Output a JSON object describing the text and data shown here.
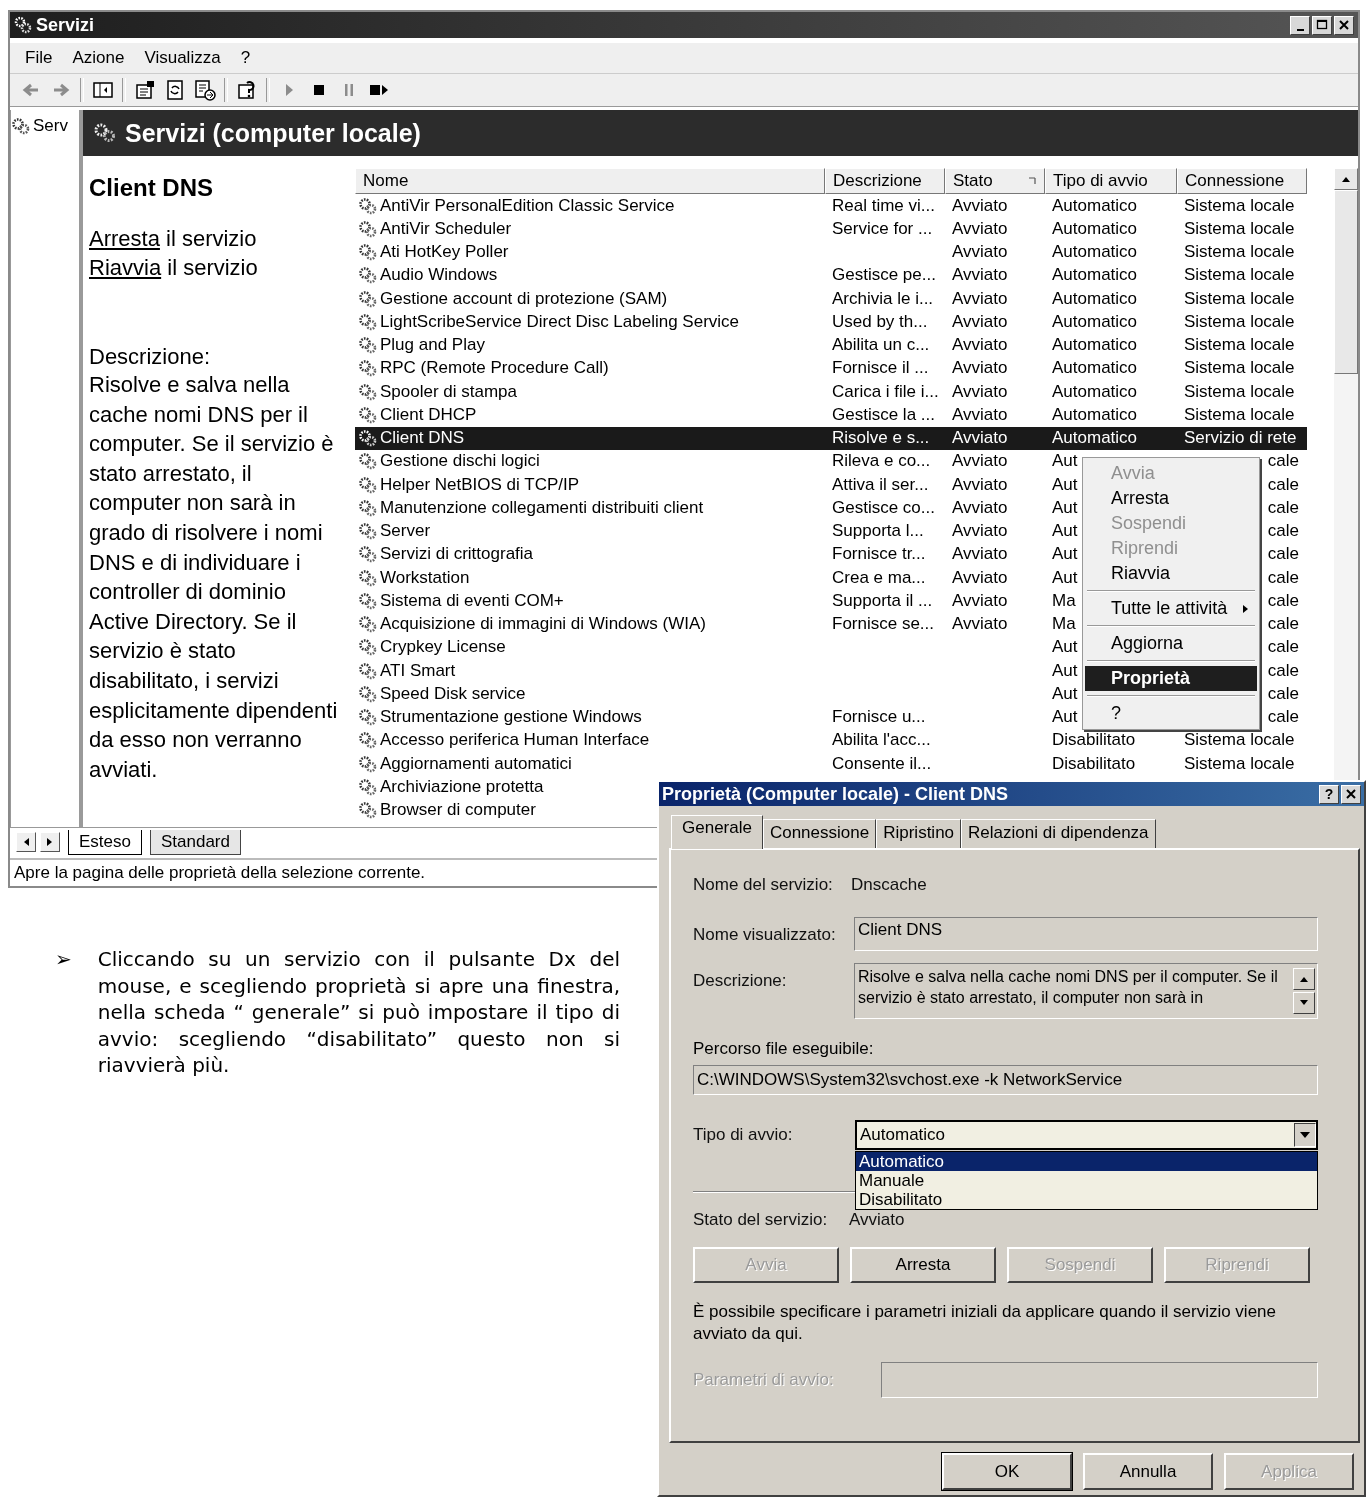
{
  "window": {
    "title": "Servizi"
  },
  "menu": [
    "File",
    "Azione",
    "Visualizza",
    "?"
  ],
  "toolbar": [
    {
      "kind": "back",
      "disabled": true
    },
    {
      "kind": "forward",
      "disabled": true
    },
    {
      "kind": "separator"
    },
    {
      "kind": "tree",
      "disabled": false
    },
    {
      "kind": "separator"
    },
    {
      "kind": "properties",
      "disabled": false
    },
    {
      "kind": "refresh",
      "disabled": false
    },
    {
      "kind": "export",
      "disabled": false
    },
    {
      "kind": "separator"
    },
    {
      "kind": "help",
      "disabled": false
    },
    {
      "kind": "separator"
    },
    {
      "kind": "play",
      "disabled": true
    },
    {
      "kind": "stop",
      "disabled": false
    },
    {
      "kind": "pause",
      "disabled": true
    },
    {
      "kind": "restart",
      "disabled": false
    }
  ],
  "tree": {
    "items": [
      {
        "label": "Serv",
        "selected": false
      }
    ]
  },
  "header": {
    "title": "Servizi (computer locale)"
  },
  "detail": {
    "title": "Client DNS",
    "actions": [
      {
        "link": "Arresta",
        "text": " il servizio"
      },
      {
        "link": "Riavvia",
        "text": " il servizio"
      }
    ],
    "description_label": "Descrizione:",
    "description": "Risolve e salva nella cache nomi DNS per il computer. Se il servizio è stato arrestato, il computer non sarà in grado di risolvere i nomi DNS e di individuare i controller di dominio Active Directory. Se il servizio è stato disabilitato, i servizi esplicitamente dipendenti da esso non verranno avviati."
  },
  "table": {
    "columns": [
      {
        "label": "Nome",
        "sorted": false
      },
      {
        "label": "Descrizione",
        "sorted": false
      },
      {
        "label": "Stato",
        "sorted": true
      },
      {
        "label": "Tipo di avvio",
        "sorted": false
      },
      {
        "label": "Connessione",
        "sorted": false
      }
    ],
    "rows": [
      {
        "name": "AntiVir PersonalEdition Classic Service",
        "description": "Real time vi...",
        "status": "Avviato",
        "startup": "Automatico",
        "logon": "Sistema locale",
        "selected": false
      },
      {
        "name": "AntiVir Scheduler",
        "description": "Service for ...",
        "status": "Avviato",
        "startup": "Automatico",
        "logon": "Sistema locale",
        "selected": false
      },
      {
        "name": "Ati HotKey Poller",
        "status": "Avviato",
        "startup": "Automatico",
        "logon": "Sistema locale",
        "selected": false
      },
      {
        "name": "Audio Windows",
        "description": "Gestisce pe...",
        "status": "Avviato",
        "startup": "Automatico",
        "logon": "Sistema locale",
        "selected": false
      },
      {
        "name": "Gestione account di protezione (SAM)",
        "description": "Archivia le i...",
        "status": "Avviato",
        "startup": "Automatico",
        "logon": "Sistema locale",
        "selected": false
      },
      {
        "name": "LightScribeService Direct Disc Labeling Service",
        "description": "Used by th...",
        "status": "Avviato",
        "startup": "Automatico",
        "logon": "Sistema locale",
        "selected": false
      },
      {
        "name": "Plug and Play",
        "description": "Abilita un c...",
        "status": "Avviato",
        "startup": "Automatico",
        "logon": "Sistema locale",
        "selected": false
      },
      {
        "name": "RPC (Remote Procedure Call)",
        "description": "Fornisce il ...",
        "status": "Avviato",
        "startup": "Automatico",
        "logon": "Sistema locale",
        "selected": false
      },
      {
        "name": "Spooler di stampa",
        "description": "Carica i file i...",
        "status": "Avviato",
        "startup": "Automatico",
        "logon": "Sistema locale",
        "selected": false
      },
      {
        "name": "Client DHCP",
        "description": "Gestisce la ...",
        "status": "Avviato",
        "startup": "Automatico",
        "logon": "Sistema locale",
        "selected": false
      },
      {
        "name": "Client DNS",
        "description": "Risolve e s...",
        "status": "Avviato",
        "startup": "Automatico",
        "logon": "Servizio di rete",
        "selected": true
      },
      {
        "name": "Gestione dischi logici",
        "description": "Rileva e co...",
        "status": "Avviato",
        "startup": "Aut",
        "logon": "cale",
        "covered": true,
        "selected": false
      },
      {
        "name": "Helper NetBIOS di TCP/IP",
        "description": "Attiva il ser...",
        "status": "Avviato",
        "startup": "Aut",
        "logon": "cale",
        "covered": true,
        "selected": false
      },
      {
        "name": "Manutenzione collegamenti distribuiti client",
        "description": "Gestisce co...",
        "status": "Avviato",
        "startup": "Aut",
        "logon": "cale",
        "covered": true,
        "selected": false
      },
      {
        "name": "Server",
        "description": "Supporta l...",
        "status": "Avviato",
        "startup": "Aut",
        "logon": "cale",
        "covered": true,
        "selected": false
      },
      {
        "name": "Servizi di crittografia",
        "description": "Fornisce tr...",
        "status": "Avviato",
        "startup": "Aut",
        "logon": "cale",
        "covered": true,
        "selected": false
      },
      {
        "name": "Workstation",
        "description": "Crea e ma...",
        "status": "Avviato",
        "startup": "Aut",
        "logon": "cale",
        "covered": true,
        "selected": false
      },
      {
        "name": "Sistema di eventi COM+",
        "description": "Supporta il ...",
        "status": "Avviato",
        "startup": "Ma",
        "logon": "cale",
        "covered": true,
        "selected": false
      },
      {
        "name": "Acquisizione di immagini di Windows (WIA)",
        "description": "Fornisce se...",
        "status": "Avviato",
        "startup": "Ma",
        "logon": "cale",
        "covered": true,
        "selected": false
      },
      {
        "name": "Crypkey License",
        "startup": "Aut",
        "logon": "cale",
        "covered": true,
        "selected": false
      },
      {
        "name": "ATI Smart",
        "startup": "Aut",
        "logon": "cale",
        "covered": true,
        "selected": false
      },
      {
        "name": "Speed Disk service",
        "startup": "Aut",
        "logon": "cale",
        "covered": true,
        "selected": false
      },
      {
        "name": "Strumentazione gestione Windows",
        "description": "Fornisce u...",
        "startup": "Aut",
        "logon": "cale",
        "covered": true,
        "selected": false
      },
      {
        "name": "Accesso periferica Human Interface",
        "description": "Abilita l'acc...",
        "startup": "Disabilitato",
        "logon": "Sistema locale",
        "selected": false
      },
      {
        "name": "Aggiornamenti automatici",
        "description": "Consente il...",
        "startup": "Disabilitato",
        "logon": "Sistema locale",
        "selected": false
      },
      {
        "name": "Archiviazione protetta",
        "selected": false
      },
      {
        "name": "Browser di computer",
        "selected": false
      }
    ]
  },
  "view_tabs": [
    {
      "label": "Esteso",
      "selected": true
    },
    {
      "label": "Standard",
      "selected": false
    }
  ],
  "status_bar": "Apre la pagina delle proprietà della selezione corrente.",
  "context_menu": [
    {
      "kind": "item",
      "label": "Avvia",
      "disabled": true,
      "selected": false
    },
    {
      "kind": "item",
      "label": "Arresta",
      "disabled": false,
      "selected": false
    },
    {
      "kind": "item",
      "label": "Sospendi",
      "disabled": true,
      "selected": false
    },
    {
      "kind": "item",
      "label": "Riprendi",
      "disabled": true,
      "selected": false
    },
    {
      "kind": "item",
      "label": "Riavvia",
      "disabled": false,
      "selected": false
    },
    {
      "kind": "separator"
    },
    {
      "kind": "submenu",
      "label": "Tutte le attività",
      "disabled": false,
      "selected": false
    },
    {
      "kind": "separator"
    },
    {
      "kind": "item",
      "label": "Aggiorna",
      "disabled": false,
      "selected": false
    },
    {
      "kind": "separator"
    },
    {
      "kind": "item",
      "label": "Proprietà",
      "disabled": false,
      "selected": true
    },
    {
      "kind": "separator"
    },
    {
      "kind": "item",
      "label": "?",
      "disabled": false,
      "selected": false
    }
  ],
  "bullet": {
    "marker": "➢",
    "text": "Cliccando su un servizio con il pulsante Dx del mouse, e scegliendo proprietà si apre una finestra, nella scheda “ generale” si può impostare il tipo di avvio: scegliendo “disabilitato” questo non si riavvierà più."
  },
  "dialog": {
    "title": "Proprietà (Computer locale) - Client DNS",
    "help": "?",
    "tabs": [
      {
        "label": "Generale",
        "selected": true
      },
      {
        "label": "Connessione",
        "selected": false
      },
      {
        "label": "Ripristino",
        "selected": false
      },
      {
        "label": "Relazioni di dipendenza",
        "selected": false
      }
    ],
    "service_name": {
      "label": "Nome del servizio:",
      "value": "Dnscache"
    },
    "display_name": {
      "label": "Nome visualizzato:",
      "value": "Client DNS"
    },
    "description": {
      "label": "Descrizione:",
      "value": "Risolve e salva nella cache nomi DNS per il computer. Se il servizio è stato arrestato, il computer non sarà in"
    },
    "path": {
      "label": "Percorso file eseguibile:",
      "value": "C:\\WINDOWS\\System32\\svchost.exe -k NetworkService"
    },
    "startup": {
      "label": "Tipo di avvio:",
      "value": "Automatico",
      "expanded": true,
      "options": [
        {
          "label": "Automatico",
          "selected": true
        },
        {
          "label": "Manuale",
          "selected": false
        },
        {
          "label": "Disabilitato",
          "selected": false
        }
      ]
    },
    "status": {
      "label": "Stato del servizio:",
      "value": "Avviato"
    },
    "service_buttons": [
      {
        "label": "Avvia",
        "disabled": true
      },
      {
        "label": "Arresta",
        "disabled": false
      },
      {
        "label": "Sospendi",
        "disabled": true
      },
      {
        "label": "Riprendi",
        "disabled": true
      }
    ],
    "note": "È possibile specificare i parametri iniziali da applicare quando il servizio viene avviato da qui.",
    "parameters": {
      "label": "Parametri di avvio:",
      "disabled": true
    },
    "buttons": [
      {
        "label": "OK",
        "disabled": false,
        "default": true
      },
      {
        "label": "Annulla",
        "disabled": false,
        "default": false
      },
      {
        "label": "Applica",
        "disabled": true,
        "default": false
      }
    ]
  }
}
